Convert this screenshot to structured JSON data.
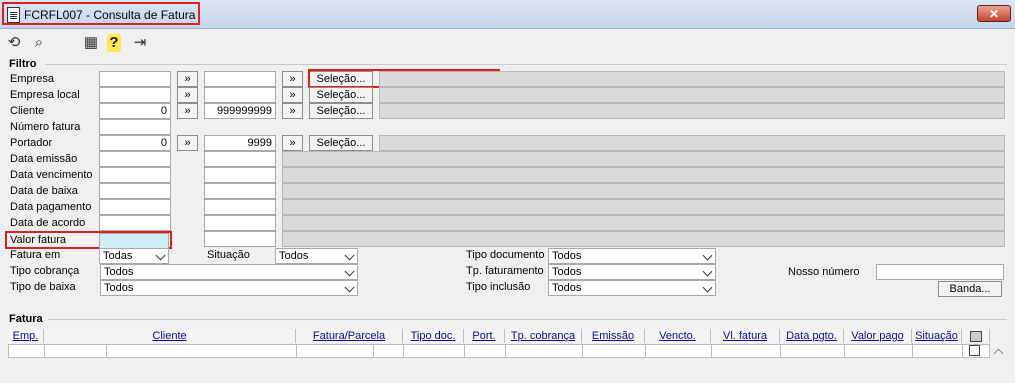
{
  "window": {
    "title": "FCRFL007 - Consulta de Fatura",
    "close_label": "✕"
  },
  "toolbar": {
    "refresh_icon": "⟲",
    "search_icon": "⌕",
    "calc_icon": "▦",
    "help_icon": "?",
    "exit_icon": "⇥"
  },
  "filtro": {
    "group_label": "Filtro",
    "labels": {
      "empresa": "Empresa",
      "empresa_local": "Empresa local",
      "cliente": "Cliente",
      "numero_fatura": "Número fatura",
      "portador": "Portador",
      "data_emissao": "Data emissão",
      "data_vencimento": "Data vencimento",
      "data_baixa": "Data de baixa",
      "data_pagamento": "Data pagamento",
      "data_acordo": "Data de acordo",
      "valor_fatura": "Valor fatura",
      "fatura_em": "Fatura em",
      "tipo_cobranca": "Tipo cobrança",
      "tipo_baixa": "Tipo de baixa",
      "situacao": "Situação",
      "tipo_documento": "Tipo documento",
      "tp_faturamento": "Tp. faturamento",
      "tipo_inclusao": "Tipo inclusão",
      "nosso_numero": "Nosso número"
    },
    "values": {
      "cliente_de": "0",
      "cliente_ate": "999999999",
      "portador_de": "0",
      "portador_ate": "9999"
    },
    "arrow_label": "»",
    "selecao_label": "Seleção...",
    "banda_label": "Banda...",
    "selects": {
      "fatura_em": "Todas",
      "situacao": "Todos",
      "tipo_cobranca": "Todos",
      "tipo_baixa": "Todos",
      "tipo_documento": "Todos",
      "tp_faturamento": "Todos",
      "tipo_inclusao": "Todos"
    }
  },
  "fatura": {
    "group_label": "Fatura",
    "columns": [
      "Emp.",
      "Cliente",
      "Fatura/Parcela",
      "Tipo doc.",
      "Port.",
      "Tp. cobrança",
      "Emissão",
      "Vencto.",
      "Vl. fatura",
      "Data pgto.",
      "Valor pago",
      "Situação"
    ]
  }
}
